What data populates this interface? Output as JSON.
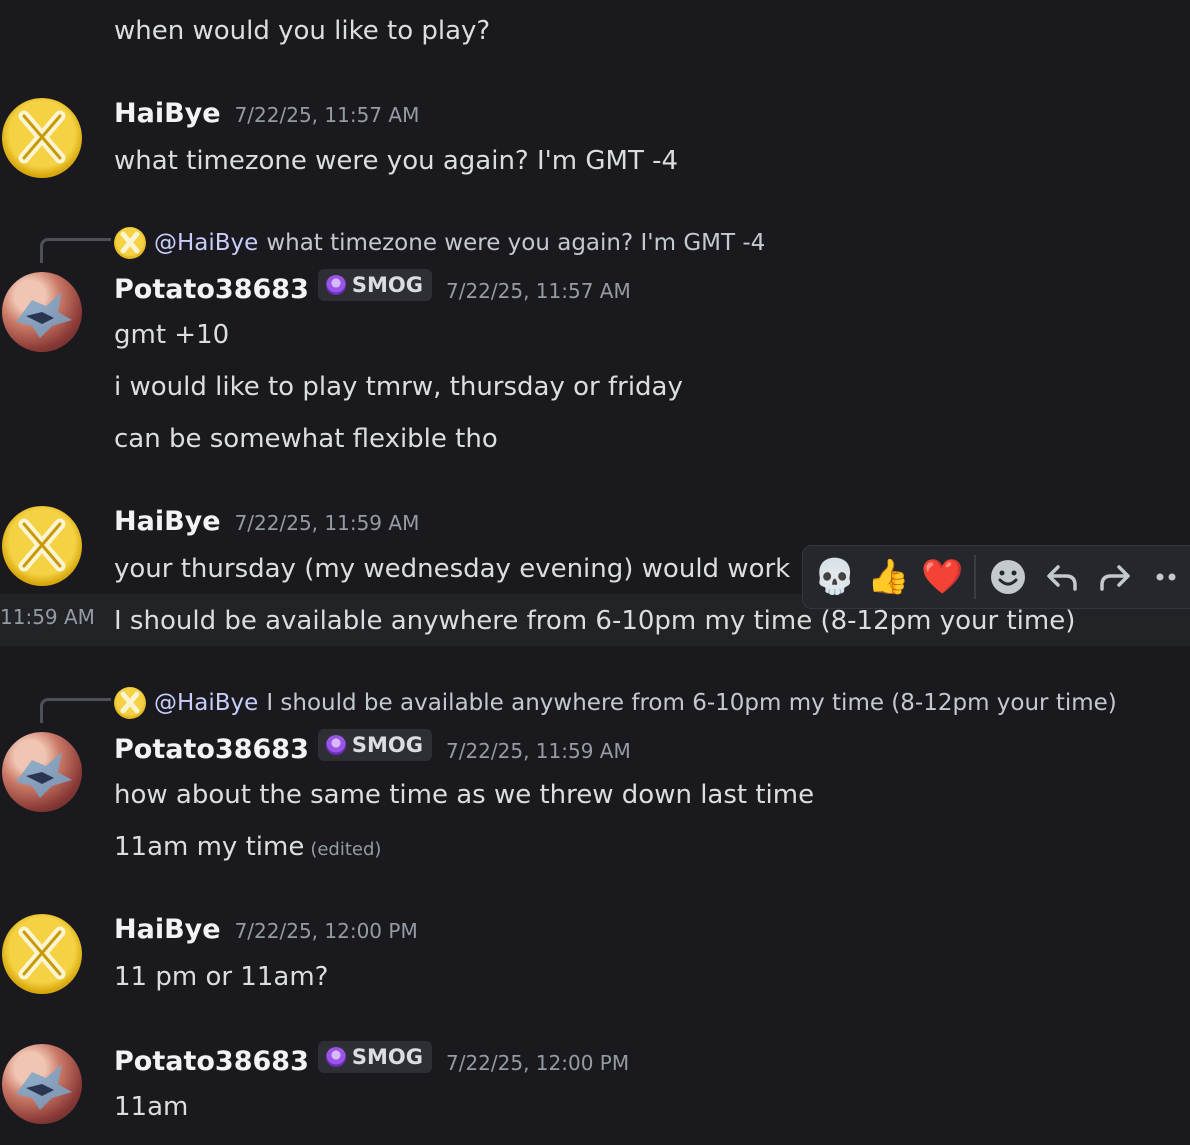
{
  "messages": {
    "top_line": "when would you like to play?",
    "m1": {
      "username": "HaiBye",
      "timestamp": "7/22/25, 11:57 AM",
      "lines": [
        "what timezone were you again? I'm GMT -4"
      ]
    },
    "m2": {
      "reply_mention": "@HaiBye",
      "reply_text": "what timezone were you again? I'm GMT -4",
      "username": "Potato38683",
      "badge": "SMOG",
      "timestamp": "7/22/25, 11:57 AM",
      "lines": [
        "gmt +10",
        "i would like to play tmrw, thursday or friday",
        "can be somewhat flexible tho"
      ]
    },
    "m3": {
      "username": "HaiBye",
      "timestamp": "7/22/25, 11:59 AM",
      "lines": [
        "your thursday (my wednesday evening) would work",
        "I should be available anywhere from 6-10pm my time (8-12pm your time)"
      ],
      "hover_time": "11:59 AM"
    },
    "m4": {
      "reply_mention": "@HaiBye",
      "reply_text": "I should be available anywhere from 6-10pm my time (8-12pm your time)",
      "username": "Potato38683",
      "badge": "SMOG",
      "timestamp": "7/22/25, 11:59 AM",
      "lines": [
        "how about the same time as we threw down last time",
        "11am my time"
      ],
      "edited": "(edited)"
    },
    "m5": {
      "username": "HaiBye",
      "timestamp": "7/22/25, 12:00 PM",
      "lines": [
        "11 pm or 11am?"
      ]
    },
    "m6": {
      "username": "Potato38683",
      "badge": "SMOG",
      "timestamp": "7/22/25, 12:00 PM",
      "lines": [
        "11am"
      ]
    }
  },
  "toolbar": {
    "reactions": [
      "💀",
      "👍",
      "❤️"
    ],
    "icons": [
      "add-reaction-icon",
      "reply-icon",
      "forward-icon",
      "more-icon"
    ]
  }
}
